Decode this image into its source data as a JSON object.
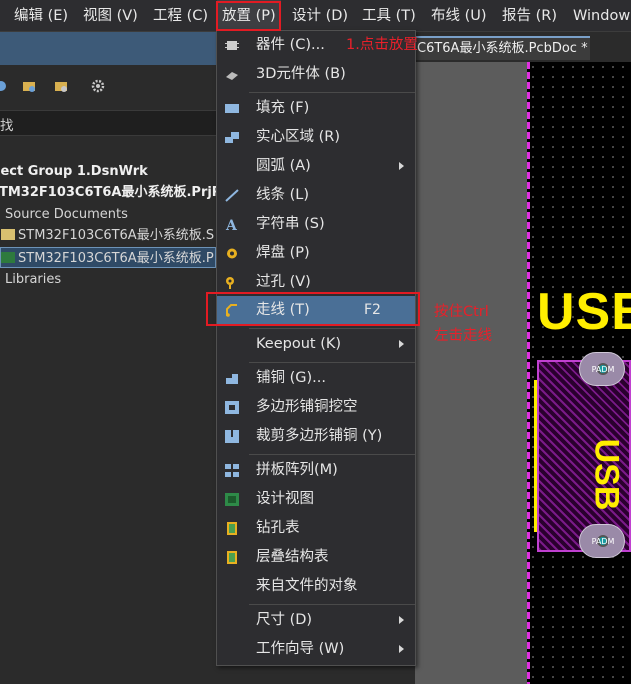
{
  "menubar": {
    "items": [
      "编辑 (E)",
      "视图 (V)",
      "工程 (C)",
      "放置 (P)",
      "设计 (D)",
      "工具 (T)",
      "布线 (U)",
      "报告 (R)",
      "Window"
    ]
  },
  "panel": {
    "search": "找",
    "tree": [
      "ject Group 1.DsnWrk",
      "TM32F103C6T6A最小系统板.PrjP",
      "Source Documents",
      "STM32F103C6T6A最小系统板.S",
      "STM32F103C6T6A最小系统板.P",
      "Libraries"
    ]
  },
  "editor": {
    "tab": "C6T6A最小系统板.PcbDoc *",
    "silk_text": "USB",
    "silk_text_vertical": "USB",
    "pad_label": "PADM"
  },
  "dropdown": {
    "items": [
      {
        "label": "器件 (C)...",
        "shortcut": "",
        "submenu": false,
        "icon": "component-icon"
      },
      {
        "label": "3D元件体 (B)",
        "shortcut": "",
        "submenu": false,
        "icon": "3d-body-icon"
      },
      {
        "label": "填充 (F)",
        "shortcut": "",
        "submenu": false,
        "icon": "fill-icon"
      },
      {
        "label": "实心区域 (R)",
        "shortcut": "",
        "submenu": false,
        "icon": "solid-region-icon"
      },
      {
        "label": "圆弧 (A)",
        "shortcut": "",
        "submenu": true,
        "icon": ""
      },
      {
        "label": "线条 (L)",
        "shortcut": "",
        "submenu": false,
        "icon": "line-icon"
      },
      {
        "label": "字符串 (S)",
        "shortcut": "",
        "submenu": false,
        "icon": "string-icon"
      },
      {
        "label": "焊盘 (P)",
        "shortcut": "",
        "submenu": false,
        "icon": "pad-icon"
      },
      {
        "label": "过孔 (V)",
        "shortcut": "",
        "submenu": false,
        "icon": "via-icon"
      },
      {
        "label": "走线 (T)",
        "shortcut": "F2",
        "submenu": false,
        "icon": "track-icon"
      },
      {
        "label": "Keepout (K)",
        "shortcut": "",
        "submenu": true,
        "icon": ""
      },
      {
        "label": "铺铜 (G)...",
        "shortcut": "",
        "submenu": false,
        "icon": "polygon-pour-icon"
      },
      {
        "label": "多边形铺铜挖空",
        "shortcut": "",
        "submenu": false,
        "icon": "polygon-cutout-icon"
      },
      {
        "label": "裁剪多边形铺铜 (Y)",
        "shortcut": "",
        "submenu": false,
        "icon": "slice-polygon-icon"
      },
      {
        "label": "拼板阵列(M)",
        "shortcut": "",
        "submenu": false,
        "icon": "panel-array-icon"
      },
      {
        "label": "设计视图",
        "shortcut": "",
        "submenu": false,
        "icon": "design-view-icon"
      },
      {
        "label": "钻孔表",
        "shortcut": "",
        "submenu": false,
        "icon": "drill-table-icon"
      },
      {
        "label": "层叠结构表",
        "shortcut": "",
        "submenu": false,
        "icon": "layer-stack-icon"
      },
      {
        "label": "来自文件的对象",
        "shortcut": "",
        "submenu": false,
        "icon": ""
      },
      {
        "label": "尺寸 (D)",
        "shortcut": "",
        "submenu": true,
        "icon": ""
      },
      {
        "label": "工作向导 (W)",
        "shortcut": "",
        "submenu": true,
        "icon": ""
      }
    ]
  },
  "annotations": {
    "step1": "1.点击放置",
    "step2_line1": "按住Ctrl",
    "step2_line2": "左击走线"
  },
  "colors": {
    "highlight_red": "#e21b23",
    "active_item": "#4a6f96",
    "silkscreen": "#ffee00"
  }
}
